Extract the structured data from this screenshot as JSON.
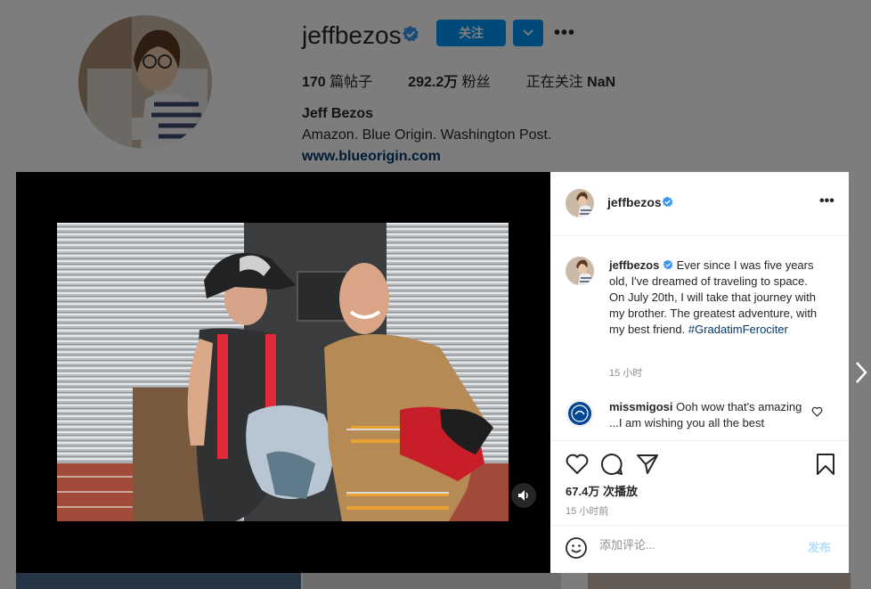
{
  "profile": {
    "username": "jeffbezos",
    "follow_label": "关注",
    "posts_count": "170",
    "posts_label": "篇帖子",
    "followers_count": "292.2万",
    "followers_label": "粉丝",
    "following_label": "正在关注",
    "following_count": "NaN",
    "full_name": "Jeff Bezos",
    "bio": "Amazon. Blue Origin. Washington Post.",
    "website": "www.blueorigin.com"
  },
  "post": {
    "header_username": "jeffbezos",
    "caption_username": "jeffbezos",
    "caption_text": "Ever since I was five years old, I've dreamed of traveling to space. On July 20th, I will take that journey with my brother. The greatest adventure, with my best friend.",
    "caption_hashtag": "#GradatimFerociter",
    "caption_time": "15 小时",
    "comment_username": "missmigosi",
    "comment_text": "Ooh wow that's amazing ...I am wishing you all the best",
    "views_count": "67.4万",
    "views_label": "次播放",
    "post_time": "15 小时前",
    "comment_placeholder": "添加评论...",
    "publish_label": "发布"
  },
  "icons": {
    "verified": "verified-badge-icon",
    "more": "more-options-icon",
    "dropdown": "chevron-down-icon",
    "like": "heart-icon",
    "comment": "comment-icon",
    "share": "share-icon",
    "save": "bookmark-icon",
    "emoji": "emoji-icon",
    "sound": "speaker-icon",
    "next": "chevron-right-icon"
  },
  "colors": {
    "accent": "#0095f6",
    "verified": "#3897f0",
    "link": "#00376b",
    "muted": "#8e8e8e",
    "publish_disabled": "#b2dffc"
  }
}
